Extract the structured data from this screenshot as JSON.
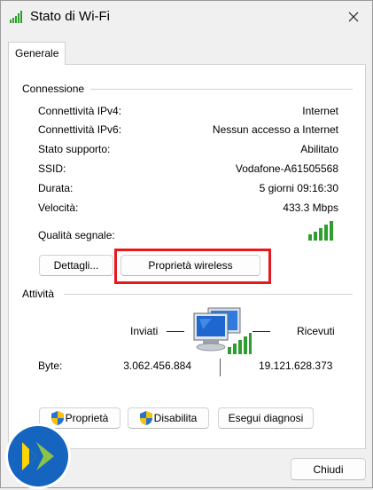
{
  "window": {
    "title": "Stato di Wi-Fi"
  },
  "tabs": [
    {
      "label": "Generale"
    }
  ],
  "connection": {
    "section_label": "Connessione",
    "rows": [
      {
        "label": "Connettività IPv4:",
        "value": "Internet"
      },
      {
        "label": "Connettività IPv6:",
        "value": "Nessun accesso a Internet"
      },
      {
        "label": "Stato supporto:",
        "value": "Abilitato"
      },
      {
        "label": "SSID:",
        "value": "Vodafone-A61505568"
      },
      {
        "label": "Durata:",
        "value": "5 giorni 09:16:30"
      },
      {
        "label": "Velocità:",
        "value": "433.3 Mbps"
      }
    ],
    "signal_label": "Qualità segnale:",
    "signal_bars": 5,
    "details_button": "Dettagli...",
    "wireless_properties_button": "Proprietà wireless"
  },
  "activity": {
    "section_label": "Attività",
    "sent_label": "Inviati",
    "received_label": "Ricevuti",
    "bytes_label": "Byte:",
    "bytes_sent": "3.062.456.884",
    "bytes_received": "19.121.628.373"
  },
  "actions": {
    "properties_button": "Proprietà",
    "disable_button": "Disabilita",
    "diagnose_button": "Esegui diagnosi"
  },
  "footer": {
    "close_button": "Chiudi"
  },
  "colors": {
    "signal_green": "#2e9e2e",
    "highlight_red": "#e8191c",
    "shield_blue": "#2a6fd6",
    "shield_yellow": "#f5c400",
    "logo_blue": "#1565c0"
  }
}
